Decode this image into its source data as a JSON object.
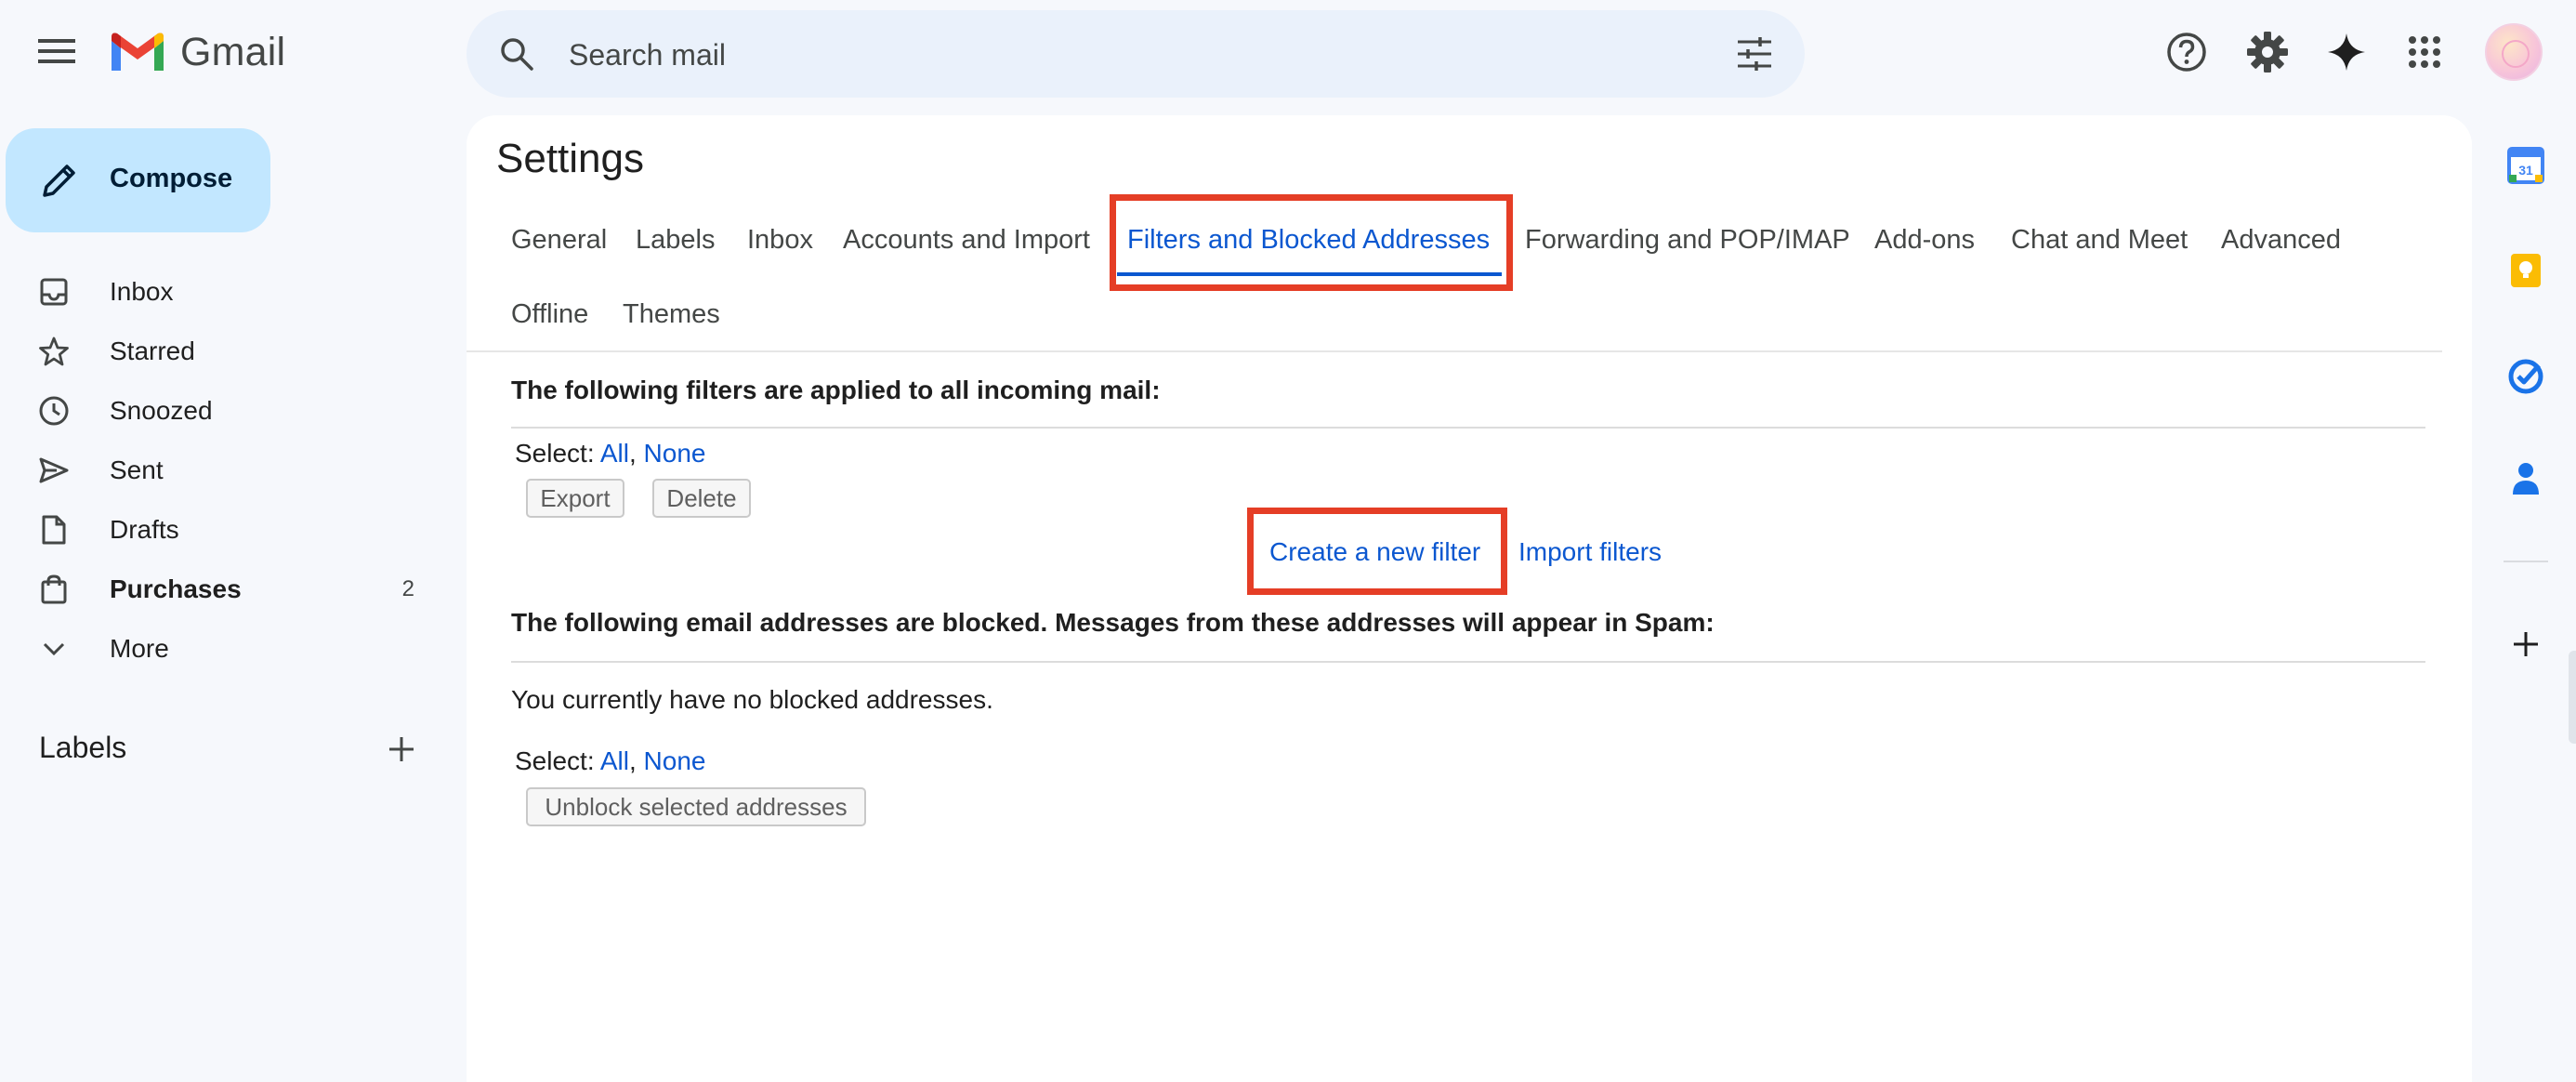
{
  "app": {
    "name": "Gmail"
  },
  "search": {
    "placeholder": "Search mail"
  },
  "compose": {
    "label": "Compose"
  },
  "nav": {
    "items": [
      {
        "label": "Inbox",
        "icon": "inbox-icon"
      },
      {
        "label": "Starred",
        "icon": "star-icon"
      },
      {
        "label": "Snoozed",
        "icon": "clock-icon"
      },
      {
        "label": "Sent",
        "icon": "send-icon"
      },
      {
        "label": "Drafts",
        "icon": "draft-icon"
      },
      {
        "label": "Purchases",
        "icon": "shopping-bag-icon",
        "count": "2",
        "bold": true
      },
      {
        "label": "More",
        "icon": "chevron-down-icon"
      }
    ],
    "labels_heading": "Labels"
  },
  "settings": {
    "title": "Settings",
    "tabs": [
      {
        "label": "General"
      },
      {
        "label": "Labels"
      },
      {
        "label": "Inbox"
      },
      {
        "label": "Accounts and Import"
      },
      {
        "label": "Filters and Blocked Addresses",
        "active": true
      },
      {
        "label": "Forwarding and POP/IMAP"
      },
      {
        "label": "Add-ons"
      },
      {
        "label": "Chat and Meet"
      },
      {
        "label": "Advanced"
      },
      {
        "label": "Offline"
      },
      {
        "label": "Themes"
      }
    ],
    "filters": {
      "heading": "The following filters are applied to all incoming mail:",
      "select_label": "Select:",
      "select_all": "All",
      "select_sep": ",",
      "select_none": "None",
      "export_label": "Export",
      "delete_label": "Delete",
      "create_link": "Create a new filter",
      "import_link": "Import filters"
    },
    "blocked": {
      "heading": "The following email addresses are blocked. Messages from these addresses will appear in Spam:",
      "empty_text": "You currently have no blocked addresses.",
      "select_label": "Select:",
      "select_all": "All",
      "select_sep": ",",
      "select_none": "None",
      "unblock_label": "Unblock selected addresses"
    }
  },
  "colors": {
    "background": "#f6f8fc",
    "accent": "#0b57d0",
    "compose_bg": "#c2e7ff",
    "highlight": "#e53e26"
  },
  "side_rail": [
    "calendar-icon",
    "keep-icon",
    "tasks-icon",
    "contacts-icon",
    "add-icon"
  ]
}
